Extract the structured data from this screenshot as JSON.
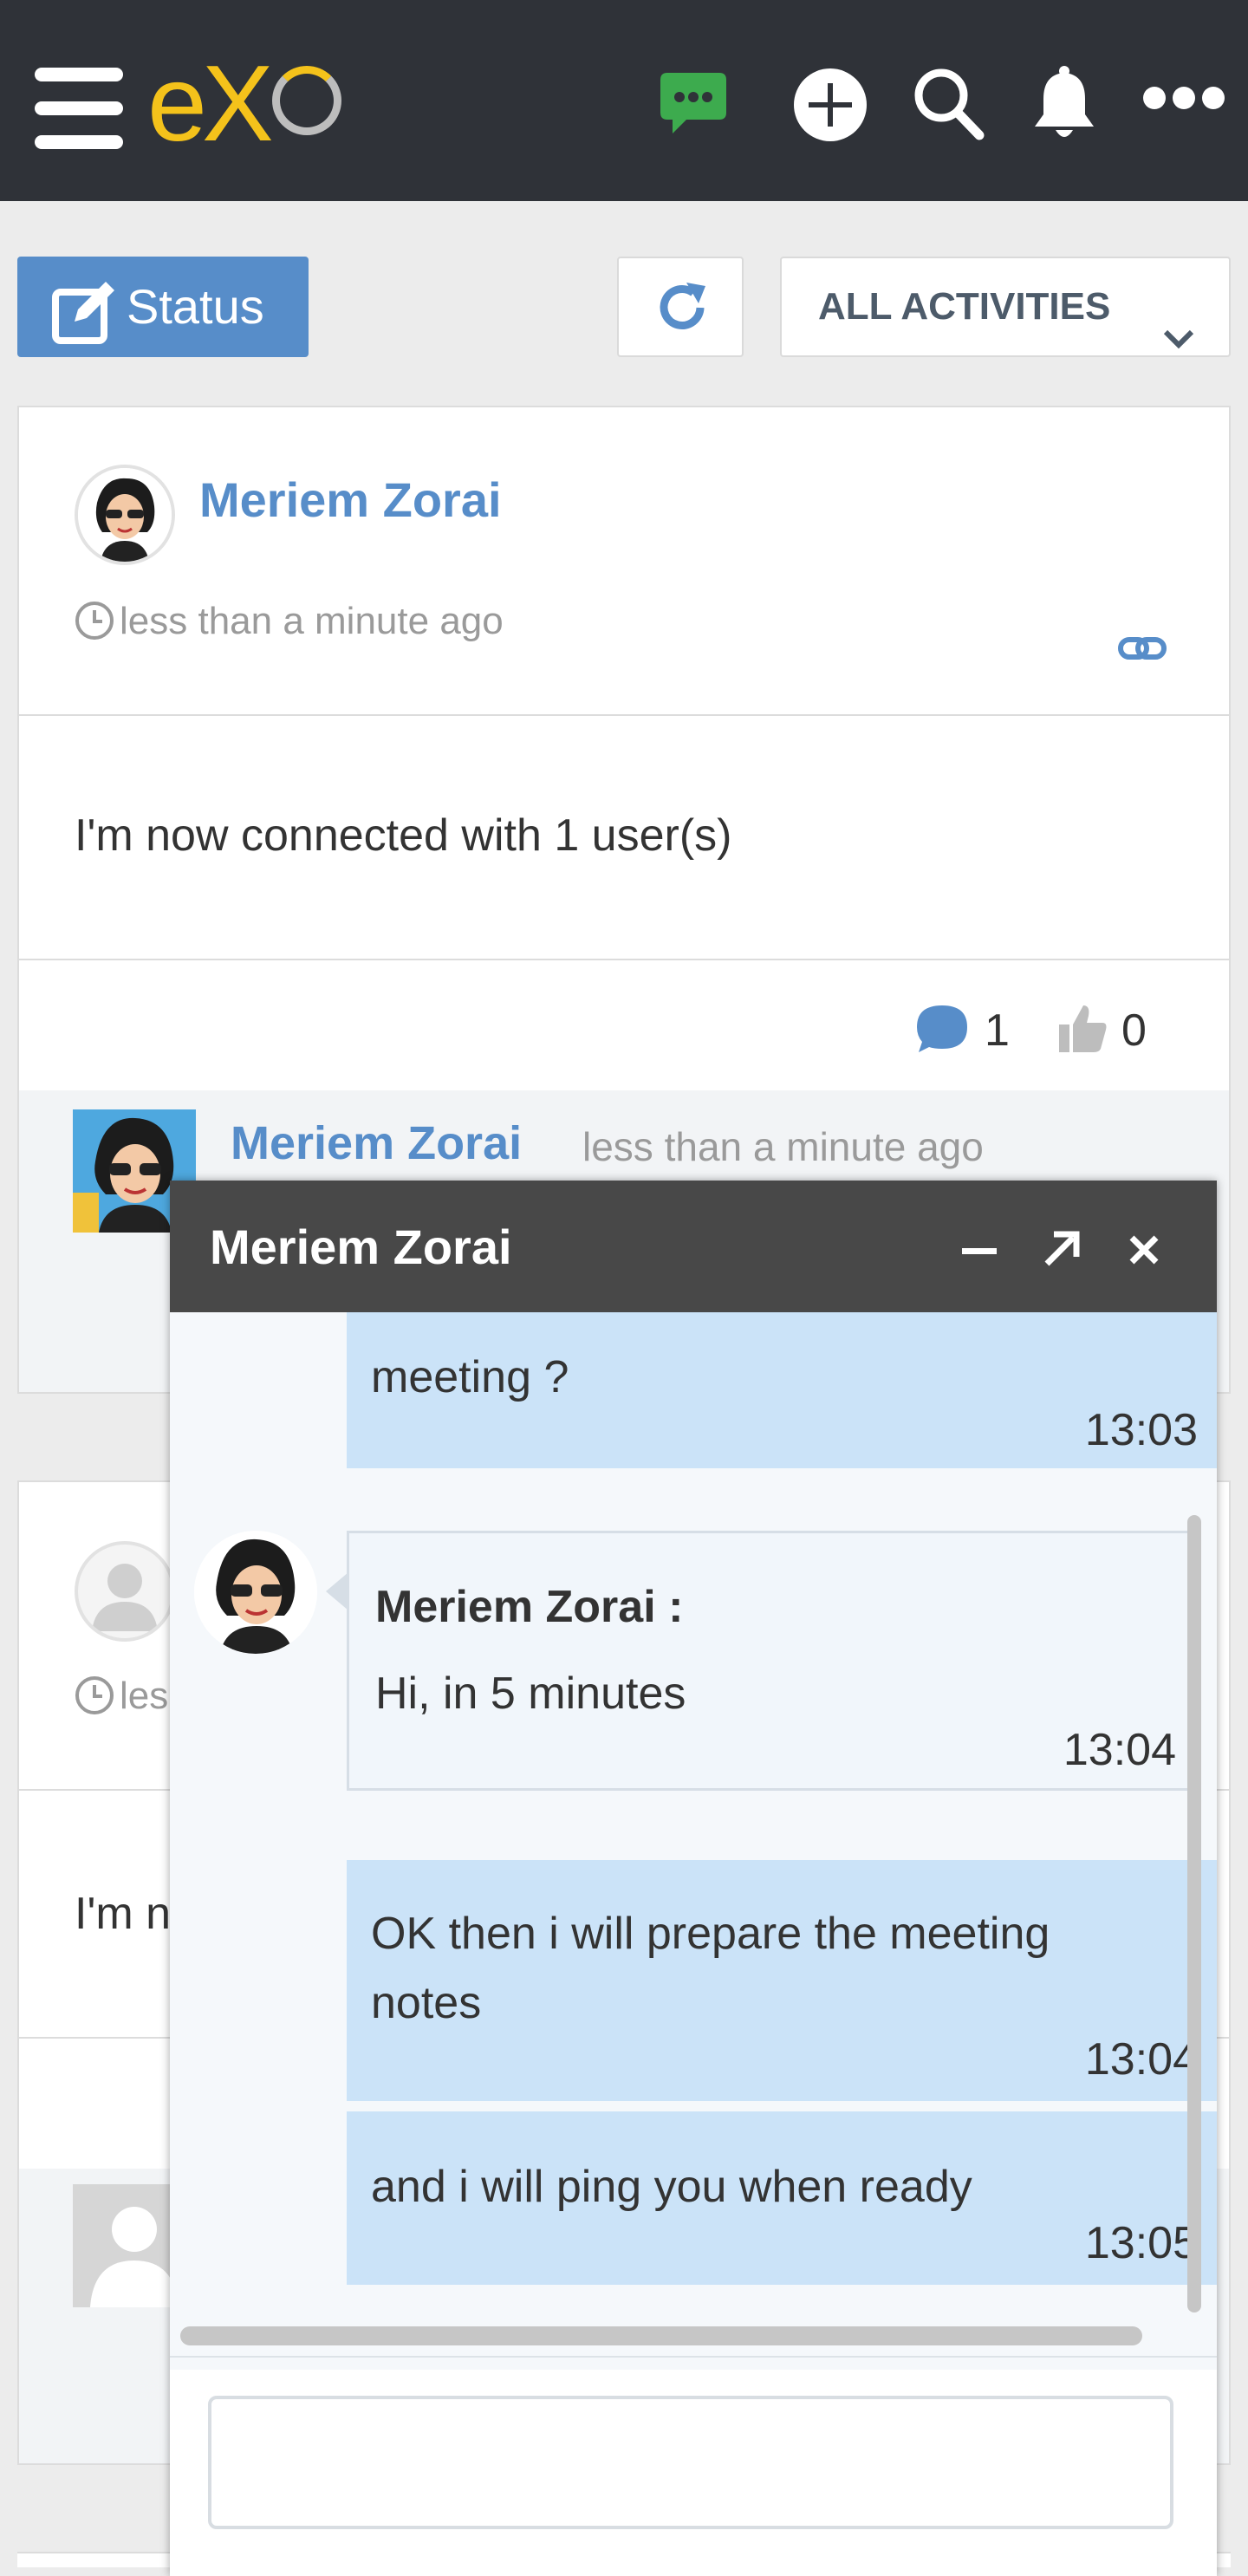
{
  "app": {
    "logo_text": "eX",
    "brand_color": "#f4c21b",
    "accent": "#578dc9"
  },
  "topbar": {
    "icons": [
      "menu-icon",
      "chat-icon",
      "add-icon",
      "search-icon",
      "notification-bell-icon",
      "more-icon"
    ],
    "chat_icon_color": "#3dab4e"
  },
  "toolbar": {
    "status_label": "Status",
    "filter_label": "ALL ACTIVITIES"
  },
  "activity_1": {
    "author": "Meriem Zorai",
    "time": "less than a minute ago",
    "text": "I'm now connected with 1 user(s)",
    "comment_count": "1",
    "like_count": "0",
    "comment": {
      "author": "Meriem Zorai",
      "time": "less than a minute ago"
    }
  },
  "activity_2": {
    "time_partial": "les",
    "text_partial": "I'm n"
  },
  "chat": {
    "title": "Meriem Zorai",
    "messages": [
      {
        "from": "me",
        "text": "meeting ?",
        "time": "13:03"
      },
      {
        "from": "other",
        "sender": "Meriem Zorai :",
        "text": "Hi, in 5 minutes",
        "time": "13:04"
      },
      {
        "from": "me",
        "text_line1": "OK then i will prepare the meeting",
        "text_line2": "notes",
        "time": "13:04"
      },
      {
        "from": "me",
        "text": "and i will ping you when ready",
        "time": "13:05"
      }
    ],
    "input_value": ""
  }
}
